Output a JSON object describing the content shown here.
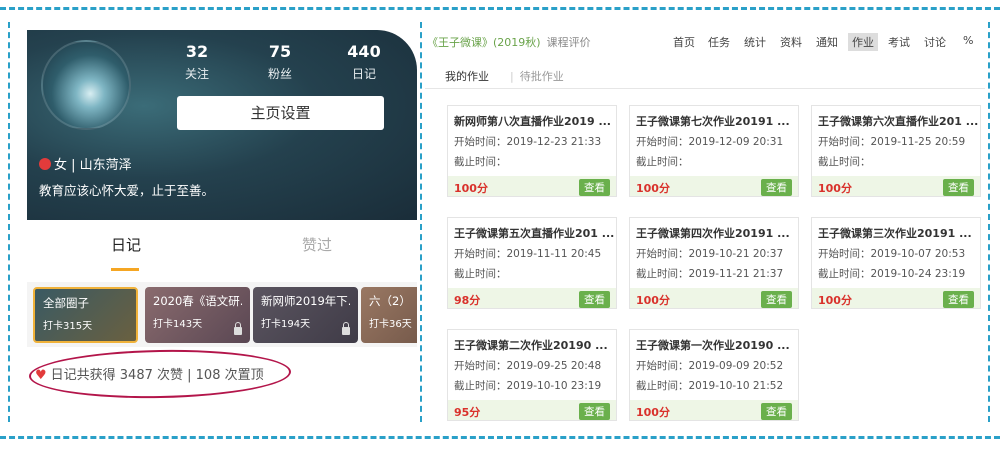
{
  "profile": {
    "stats": [
      {
        "num": "32",
        "label": "关注"
      },
      {
        "num": "75",
        "label": "粉丝"
      },
      {
        "num": "440",
        "label": "日记"
      }
    ],
    "home_button": "主页设置",
    "gender_location": "女 | 山东菏泽",
    "bio": "教育应该心怀大爱，止于至善。",
    "tabs": [
      "日记",
      "赞过"
    ],
    "circles": [
      {
        "title": "全部圈子",
        "sub": "打卡315天"
      },
      {
        "title": "2020春《语文研...",
        "sub": "打卡143天"
      },
      {
        "title": "新网师2019年下...",
        "sub": "打卡194天"
      },
      {
        "title": "六（2）",
        "sub": "打卡36天"
      }
    ],
    "likes_text": "日记共获得 3487 次赞 | 108 次置顶"
  },
  "web": {
    "course": "《王子微课》(2019秋)",
    "course_sub": "课程评价",
    "nav": [
      "首页",
      "任务",
      "统计",
      "资料",
      "通知",
      "作业",
      "考试",
      "讨论",
      "%"
    ],
    "tabs": [
      "我的作业",
      "待批作业"
    ],
    "start_label": "开始时间：",
    "end_label": "截止时间：",
    "view_label": "查看",
    "cards": [
      {
        "title": "新网师第八次直播作业2019 ...",
        "start": "2019-12-23 21:33",
        "end": "",
        "score": "100分"
      },
      {
        "title": "王子微课第七次作业20191 ...",
        "start": "2019-12-09 20:31",
        "end": "",
        "score": "100分"
      },
      {
        "title": "王子微课第六次直播作业201 ...",
        "start": "2019-11-25 20:59",
        "end": "",
        "score": "100分"
      },
      {
        "title": "王子微课第五次直播作业201 ...",
        "start": "2019-11-11 20:45",
        "end": "",
        "score": "98分"
      },
      {
        "title": "王子微课第四次作业20191 ...",
        "start": "2019-10-21 20:37",
        "end": "2019-11-21 21:37",
        "score": "100分"
      },
      {
        "title": "王子微课第三次作业20191 ...",
        "start": "2019-10-07 20:53",
        "end": "2019-10-24 23:19",
        "score": "100分"
      },
      {
        "title": "王子微课第二次作业20190 ...",
        "start": "2019-09-25 20:48",
        "end": "2019-10-10 23:19",
        "score": "95分"
      },
      {
        "title": "王子微课第一次作业20190 ...",
        "start": "2019-09-09 20:52",
        "end": "2019-10-10 21:52",
        "score": "100分"
      }
    ]
  }
}
